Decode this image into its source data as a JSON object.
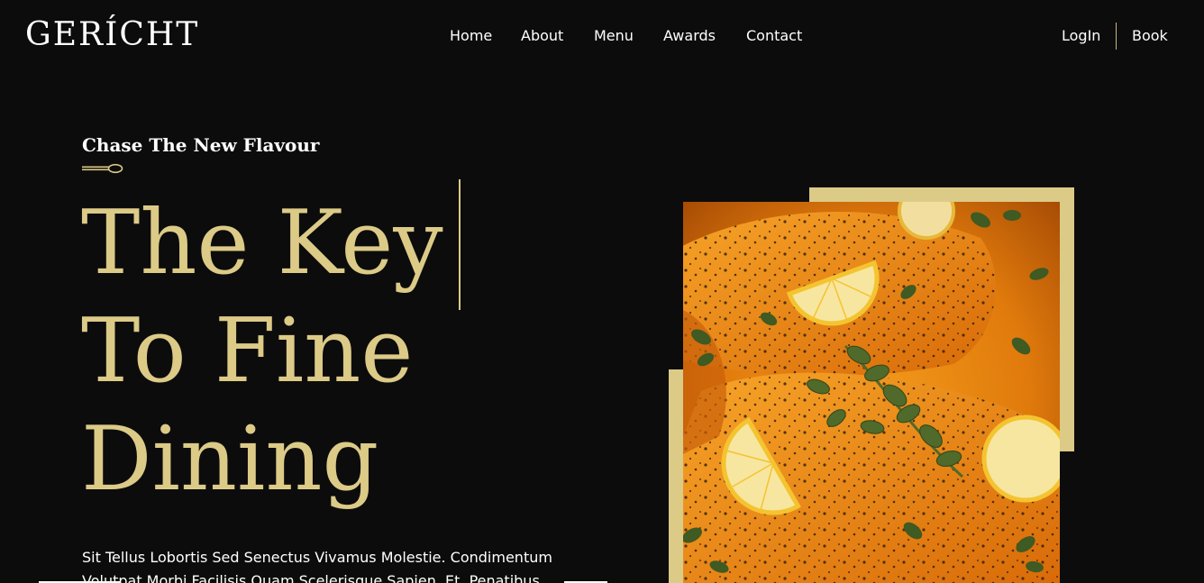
{
  "brand": {
    "logo": "GERÍCHT"
  },
  "nav": {
    "links": [
      "Home",
      "About",
      "Menu",
      "Awards",
      "Contact"
    ],
    "login": "LogIn",
    "book": "Book"
  },
  "hero": {
    "subtitle": "Chase The New Flavour",
    "headline_lines": [
      "The Key",
      "To Fine",
      "Dining"
    ],
    "description": "Sit Tellus Lobortis Sed Senectus Vivamus Molestie. Condimentum Volutpat Morbi Facilisis Quam Scelerisque Sapien. Et, Penatibus"
  },
  "image": {
    "subject": "salmon-with-lemon-and-oregano"
  },
  "colors": {
    "background": "#0c0c0c",
    "accent_gold": "#dcca87",
    "text": "#ffffff"
  }
}
